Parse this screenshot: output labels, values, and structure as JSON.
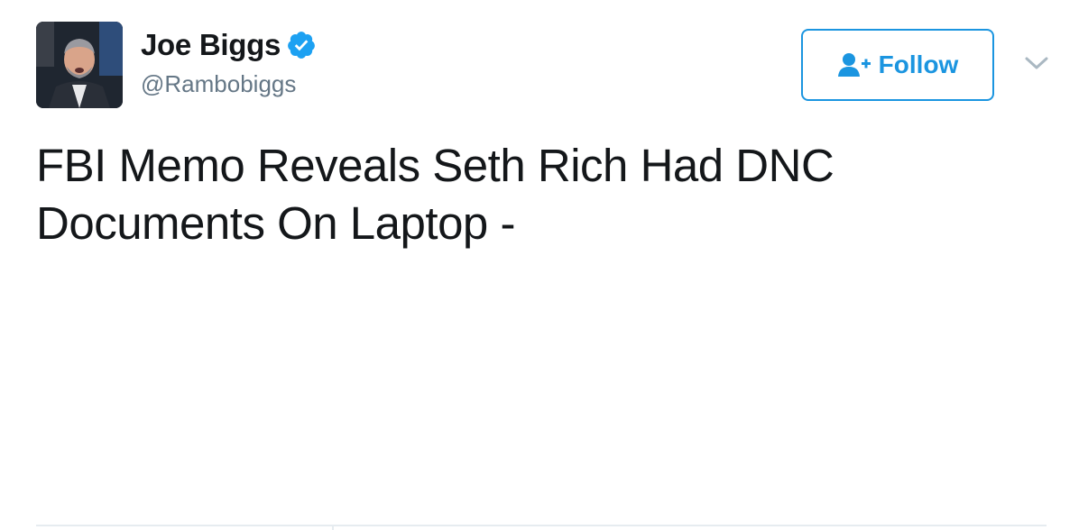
{
  "author": {
    "display_name": "Joe Biggs",
    "handle": "@Rambobiggs",
    "verified": true
  },
  "follow_button": {
    "label": "Follow",
    "icon": "add-user-icon"
  },
  "menu": {
    "icon": "chevron-down-icon"
  },
  "tweet": {
    "text": "FBI Memo Reveals Seth Rich Had DNC Documents On Laptop -"
  },
  "colors": {
    "accent": "#1b95e0",
    "verified": "#1da1f2",
    "text": "#14171a",
    "secondary_text": "#657786",
    "divider": "#e6ecf0"
  }
}
